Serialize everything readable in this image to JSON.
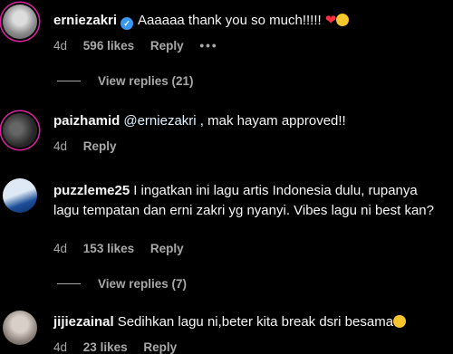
{
  "comments": [
    {
      "username": "erniezakri",
      "verified": true,
      "text": "Aaaaaa thank you so much!!!!!",
      "age": "4d",
      "likes": "596 likes",
      "reply": "Reply",
      "more": "•••",
      "view_replies": "View replies (21)"
    },
    {
      "username": "paizhamid",
      "mention": "@erniezakri",
      "text": ", mak hayam approved!!",
      "age": "4d",
      "reply": "Reply"
    },
    {
      "username": "puzzleme25",
      "text": "I ingatkan ini lagu artis Indonesia dulu, rupanya lagu tempatan dan erni zakri yg nyanyi. Vibes lagu ni best kan?",
      "age": "4d",
      "likes": "153 likes",
      "reply": "Reply",
      "view_replies": "View replies (7)"
    },
    {
      "username": "jijiezainal",
      "text": "Sedihkan lagu ni,beter kita break dsri besama",
      "age": "4d",
      "likes": "23 likes",
      "reply": "Reply"
    }
  ],
  "icons": {
    "verified": "verified-badge-icon",
    "heart": "red-heart-emoji",
    "pleading": "pleading-face-emoji"
  },
  "colors": {
    "background": "#000000",
    "text": "#f5f5f5",
    "muted": "#a8a8a8",
    "verified": "#3897f0",
    "story_ring": "#d6249f"
  }
}
